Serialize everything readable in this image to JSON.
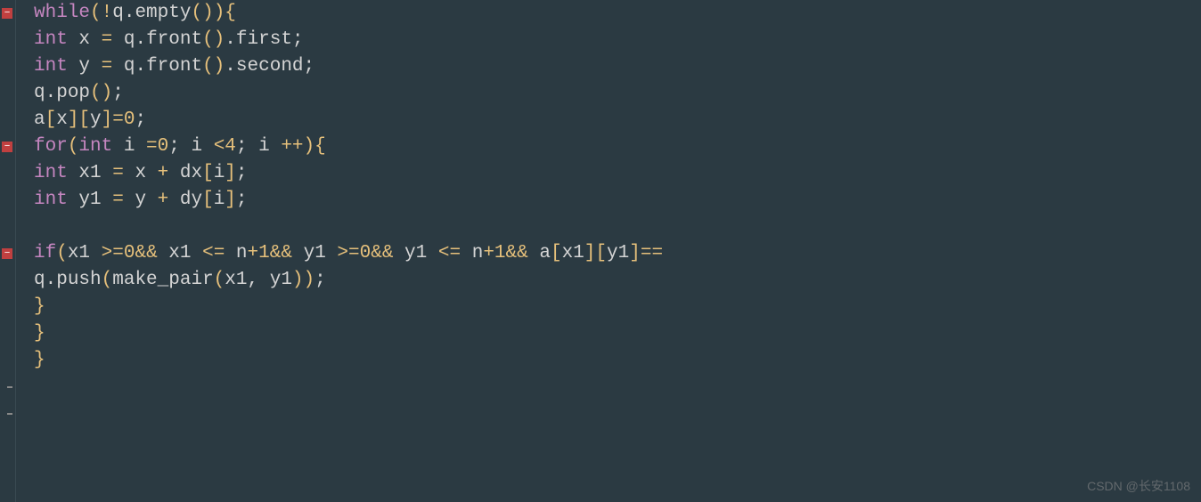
{
  "code": {
    "lines": [
      {
        "indent": 1,
        "tokens": [
          {
            "t": "while",
            "c": "kw"
          },
          {
            "t": " ",
            "c": ""
          },
          {
            "t": "(",
            "c": "paren"
          },
          {
            "t": "!",
            "c": "op"
          },
          {
            "t": "q",
            "c": "var"
          },
          {
            "t": ".",
            "c": "punct"
          },
          {
            "t": "empty",
            "c": "func"
          },
          {
            "t": "()",
            "c": "paren"
          },
          {
            "t": ")",
            "c": "paren"
          },
          {
            "t": " ",
            "c": ""
          },
          {
            "t": "{",
            "c": "brace"
          }
        ]
      },
      {
        "indent": 2,
        "tokens": [
          {
            "t": "int",
            "c": "type"
          },
          {
            "t": " x ",
            "c": "var"
          },
          {
            "t": "=",
            "c": "op"
          },
          {
            "t": " q",
            "c": "var"
          },
          {
            "t": ".",
            "c": "punct"
          },
          {
            "t": "front",
            "c": "func"
          },
          {
            "t": "()",
            "c": "paren"
          },
          {
            "t": ".",
            "c": "punct"
          },
          {
            "t": "first",
            "c": "var"
          },
          {
            "t": ";",
            "c": "punct"
          }
        ]
      },
      {
        "indent": 2,
        "tokens": [
          {
            "t": "int",
            "c": "type"
          },
          {
            "t": " y ",
            "c": "var"
          },
          {
            "t": "=",
            "c": "op"
          },
          {
            "t": " q",
            "c": "var"
          },
          {
            "t": ".",
            "c": "punct"
          },
          {
            "t": "front",
            "c": "func"
          },
          {
            "t": "()",
            "c": "paren"
          },
          {
            "t": ".",
            "c": "punct"
          },
          {
            "t": "second",
            "c": "var"
          },
          {
            "t": ";",
            "c": "punct"
          }
        ]
      },
      {
        "indent": 2,
        "tokens": [
          {
            "t": "q",
            "c": "var"
          },
          {
            "t": ".",
            "c": "punct"
          },
          {
            "t": "pop",
            "c": "func"
          },
          {
            "t": "()",
            "c": "paren"
          },
          {
            "t": ";",
            "c": "punct"
          }
        ]
      },
      {
        "indent": 2,
        "tokens": [
          {
            "t": "a",
            "c": "var"
          },
          {
            "t": "[",
            "c": "bracket"
          },
          {
            "t": "x",
            "c": "var"
          },
          {
            "t": "][",
            "c": "bracket"
          },
          {
            "t": "y",
            "c": "var"
          },
          {
            "t": "]",
            "c": "bracket"
          },
          {
            "t": " ",
            "c": ""
          },
          {
            "t": "=",
            "c": "op"
          },
          {
            "t": " ",
            "c": ""
          },
          {
            "t": "0",
            "c": "num"
          },
          {
            "t": ";",
            "c": "punct"
          }
        ]
      },
      {
        "indent": 2,
        "tokens": [
          {
            "t": "for",
            "c": "kw"
          },
          {
            "t": " ",
            "c": ""
          },
          {
            "t": "(",
            "c": "paren"
          },
          {
            "t": "int",
            "c": "type"
          },
          {
            "t": " i ",
            "c": "var"
          },
          {
            "t": "=",
            "c": "op"
          },
          {
            "t": " ",
            "c": ""
          },
          {
            "t": "0",
            "c": "num"
          },
          {
            "t": ";",
            "c": "punct"
          },
          {
            "t": " i ",
            "c": "var"
          },
          {
            "t": "<",
            "c": "op"
          },
          {
            "t": " ",
            "c": ""
          },
          {
            "t": "4",
            "c": "num"
          },
          {
            "t": ";",
            "c": "punct"
          },
          {
            "t": " i ",
            "c": "var"
          },
          {
            "t": "++",
            "c": "op"
          },
          {
            "t": " ",
            "c": ""
          },
          {
            "t": ")",
            "c": "paren"
          },
          {
            "t": " ",
            "c": ""
          },
          {
            "t": "{",
            "c": "brace"
          }
        ]
      },
      {
        "indent": 3,
        "tokens": [
          {
            "t": "int",
            "c": "type"
          },
          {
            "t": " x1 ",
            "c": "var"
          },
          {
            "t": "=",
            "c": "op"
          },
          {
            "t": " x ",
            "c": "var"
          },
          {
            "t": "+",
            "c": "op"
          },
          {
            "t": " dx",
            "c": "var"
          },
          {
            "t": "[",
            "c": "bracket"
          },
          {
            "t": "i",
            "c": "var"
          },
          {
            "t": "]",
            "c": "bracket"
          },
          {
            "t": ";",
            "c": "punct"
          }
        ]
      },
      {
        "indent": 3,
        "tokens": [
          {
            "t": "int",
            "c": "type"
          },
          {
            "t": " y1 ",
            "c": "var"
          },
          {
            "t": "=",
            "c": "op"
          },
          {
            "t": " y ",
            "c": "var"
          },
          {
            "t": "+",
            "c": "op"
          },
          {
            "t": " dy",
            "c": "var"
          },
          {
            "t": "[",
            "c": "bracket"
          },
          {
            "t": "i",
            "c": "var"
          },
          {
            "t": "]",
            "c": "bracket"
          },
          {
            "t": ";",
            "c": "punct"
          }
        ]
      },
      {
        "indent": 3,
        "tokens": []
      },
      {
        "indent": 3,
        "tokens": [
          {
            "t": "if",
            "c": "kw"
          },
          {
            "t": " ",
            "c": ""
          },
          {
            "t": "(",
            "c": "paren"
          },
          {
            "t": "x1 ",
            "c": "var"
          },
          {
            "t": ">=",
            "c": "op"
          },
          {
            "t": " ",
            "c": ""
          },
          {
            "t": "0",
            "c": "num"
          },
          {
            "t": " ",
            "c": ""
          },
          {
            "t": "&&",
            "c": "op"
          },
          {
            "t": " x1 ",
            "c": "var"
          },
          {
            "t": "<=",
            "c": "op"
          },
          {
            "t": " n",
            "c": "var"
          },
          {
            "t": "+",
            "c": "op"
          },
          {
            "t": "1",
            "c": "num"
          },
          {
            "t": " ",
            "c": ""
          },
          {
            "t": "&&",
            "c": "op"
          },
          {
            "t": " y1 ",
            "c": "var"
          },
          {
            "t": ">=",
            "c": "op"
          },
          {
            "t": " ",
            "c": ""
          },
          {
            "t": "0",
            "c": "num"
          },
          {
            "t": " ",
            "c": ""
          },
          {
            "t": "&&",
            "c": "op"
          },
          {
            "t": " y1 ",
            "c": "var"
          },
          {
            "t": "<=",
            "c": "op"
          },
          {
            "t": " n",
            "c": "var"
          },
          {
            "t": "+",
            "c": "op"
          },
          {
            "t": "1",
            "c": "num"
          },
          {
            "t": " ",
            "c": ""
          },
          {
            "t": "&&",
            "c": "op"
          },
          {
            "t": " a",
            "c": "var"
          },
          {
            "t": "[",
            "c": "bracket"
          },
          {
            "t": "x1",
            "c": "var"
          },
          {
            "t": "][",
            "c": "bracket"
          },
          {
            "t": "y1",
            "c": "var"
          },
          {
            "t": "]",
            "c": "bracket"
          },
          {
            "t": " ",
            "c": ""
          },
          {
            "t": "==",
            "c": "op"
          }
        ]
      },
      {
        "indent": 4,
        "tokens": [
          {
            "t": "q",
            "c": "var"
          },
          {
            "t": ".",
            "c": "punct"
          },
          {
            "t": "push",
            "c": "func"
          },
          {
            "t": "(",
            "c": "paren"
          },
          {
            "t": "make_pair",
            "c": "func"
          },
          {
            "t": "(",
            "c": "paren"
          },
          {
            "t": "x1",
            "c": "var"
          },
          {
            "t": ",",
            "c": "punct"
          },
          {
            "t": " y1",
            "c": "var"
          },
          {
            "t": "))",
            "c": "paren"
          },
          {
            "t": ";",
            "c": "punct"
          }
        ]
      },
      {
        "indent": 3,
        "tokens": [
          {
            "t": "}",
            "c": "brace"
          }
        ]
      },
      {
        "indent": 2,
        "tokens": [
          {
            "t": "}",
            "c": "brace"
          }
        ]
      },
      {
        "indent": 1,
        "tokens": [
          {
            "t": "}",
            "c": "brace"
          }
        ]
      }
    ]
  },
  "gutter": {
    "fold_markers": [
      0,
      5,
      9
    ],
    "tick_markers": [
      14,
      15
    ]
  },
  "watermark": "CSDN @长安1108"
}
